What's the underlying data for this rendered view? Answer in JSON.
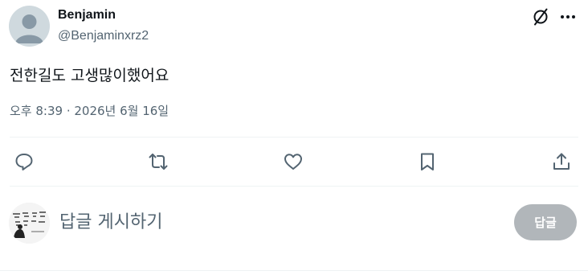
{
  "author": {
    "display_name": "Benjamin",
    "handle": "@Benjaminxrz2"
  },
  "tweet": {
    "text": "전한길도 고생많이했어요",
    "timestamp": "오후 8:39 · 2026년 6월 16일"
  },
  "header_icons": [
    "grok-icon",
    "more-icon"
  ],
  "actions": [
    "reply-icon",
    "repost-icon",
    "like-icon",
    "bookmark-icon",
    "share-icon"
  ],
  "composer": {
    "placeholder": "답글 게시하기",
    "button_label": "답글"
  },
  "colors": {
    "text_primary": "#0f1419",
    "text_secondary": "#536471",
    "divider": "#eff3f4",
    "button_disabled": "#b1b6ba"
  }
}
